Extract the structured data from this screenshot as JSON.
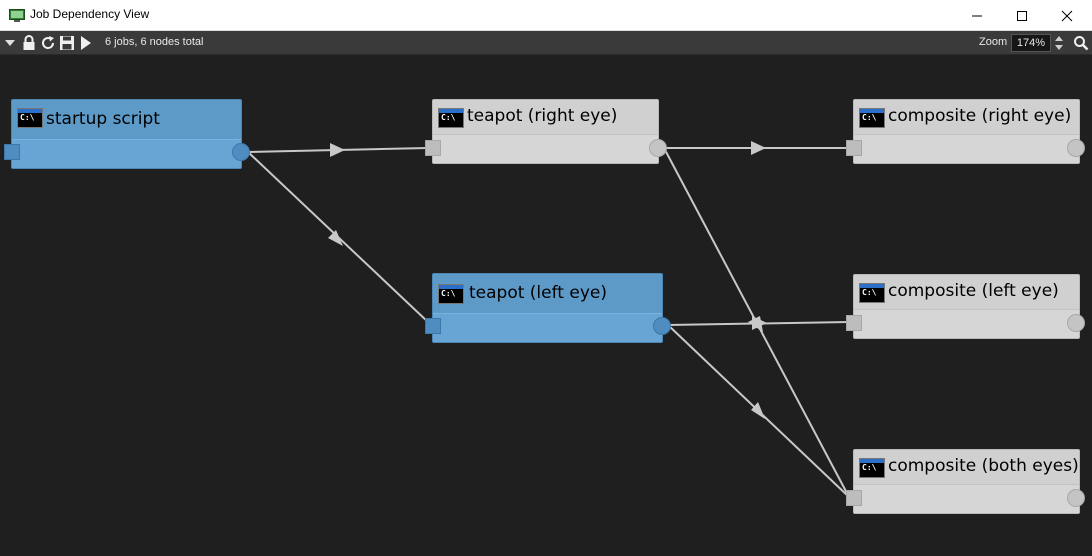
{
  "window": {
    "title": "Job Dependency View",
    "icon": "monitor-app-icon"
  },
  "toolbar": {
    "status": "6 jobs, 6 nodes total",
    "zoom_label": "Zoom",
    "zoom_value": "174%",
    "icons": [
      "dropdown-arrow-icon",
      "lock-icon",
      "refresh-icon",
      "save-icon",
      "play-icon",
      "search-icon"
    ]
  },
  "nodes": [
    {
      "id": "startup",
      "title": "startup script",
      "state": "selected",
      "icon": "command-prompt-icon",
      "icon_text": "C:\\"
    },
    {
      "id": "teapot-right",
      "title": "teapot (right eye)",
      "state": "normal",
      "icon": "command-prompt-icon",
      "icon_text": "C:\\"
    },
    {
      "id": "teapot-left",
      "title": "teapot (left eye)",
      "state": "selected",
      "icon": "command-prompt-icon",
      "icon_text": "C:\\"
    },
    {
      "id": "comp-right",
      "title": "composite (right eye)",
      "state": "normal",
      "icon": "command-prompt-icon",
      "icon_text": "C:\\"
    },
    {
      "id": "comp-left",
      "title": "composite (left eye)",
      "state": "normal",
      "icon": "command-prompt-icon",
      "icon_text": "C:\\"
    },
    {
      "id": "comp-both",
      "title": "composite (both eyes)",
      "state": "normal",
      "icon": "command-prompt-icon",
      "icon_text": "C:\\"
    }
  ],
  "edges": [
    {
      "from": "startup",
      "to": "teapot-right"
    },
    {
      "from": "startup",
      "to": "teapot-left"
    },
    {
      "from": "teapot-right",
      "to": "comp-right"
    },
    {
      "from": "teapot-right",
      "to": "comp-both"
    },
    {
      "from": "teapot-left",
      "to": "comp-left"
    },
    {
      "from": "teapot-left",
      "to": "comp-both"
    }
  ],
  "colors": {
    "background": "#1f1f1f",
    "selected_node": "#5d9ac8",
    "normal_node": "#d0d0d0",
    "edge": "#c8c8c8"
  }
}
